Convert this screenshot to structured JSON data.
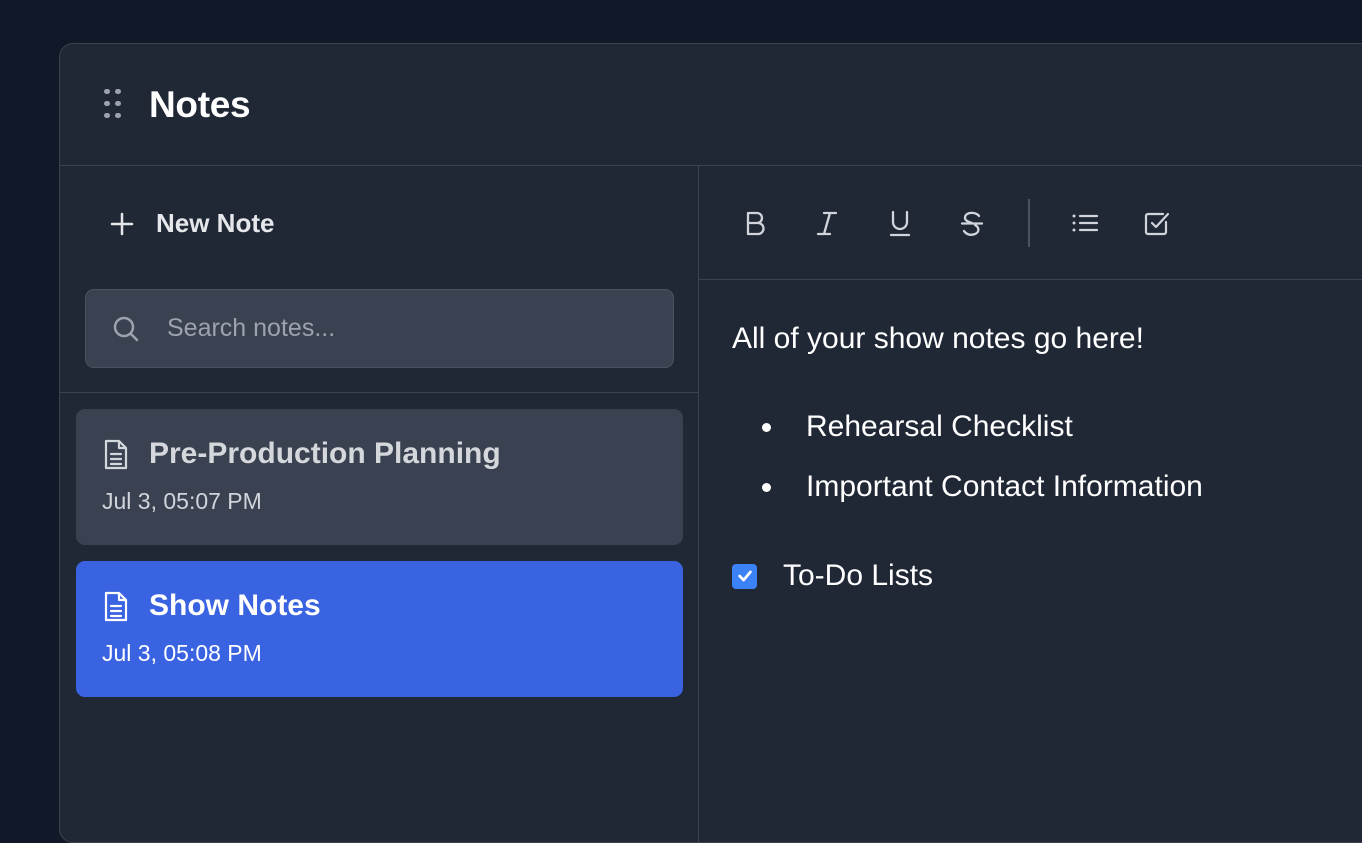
{
  "header": {
    "title": "Notes",
    "drag_icon": "drag-handle-icon"
  },
  "sidebar": {
    "new_note_label": "New Note",
    "search_placeholder": "Search notes...",
    "notes": [
      {
        "title": "Pre-Production Planning",
        "date": "Jul 3, 05:07 PM",
        "active": false
      },
      {
        "title": "Show Notes",
        "date": "Jul 3, 05:08 PM",
        "active": true
      }
    ]
  },
  "toolbar": {
    "tools": [
      "bold-icon",
      "italic-icon",
      "underline-icon",
      "strikethrough-icon",
      "bullet-list-icon",
      "checkbox-list-icon"
    ]
  },
  "editor": {
    "intro": "All of your show notes go here!",
    "bullets": [
      "Rehearsal Checklist",
      "Important Contact Information"
    ],
    "todo": {
      "text": "To-Do Lists",
      "checked": true
    }
  },
  "colors": {
    "background": "#111827",
    "panel": "#202735",
    "item_inactive": "#3a4150",
    "item_active": "#3a63e1",
    "checkbox": "#3b82f6"
  }
}
